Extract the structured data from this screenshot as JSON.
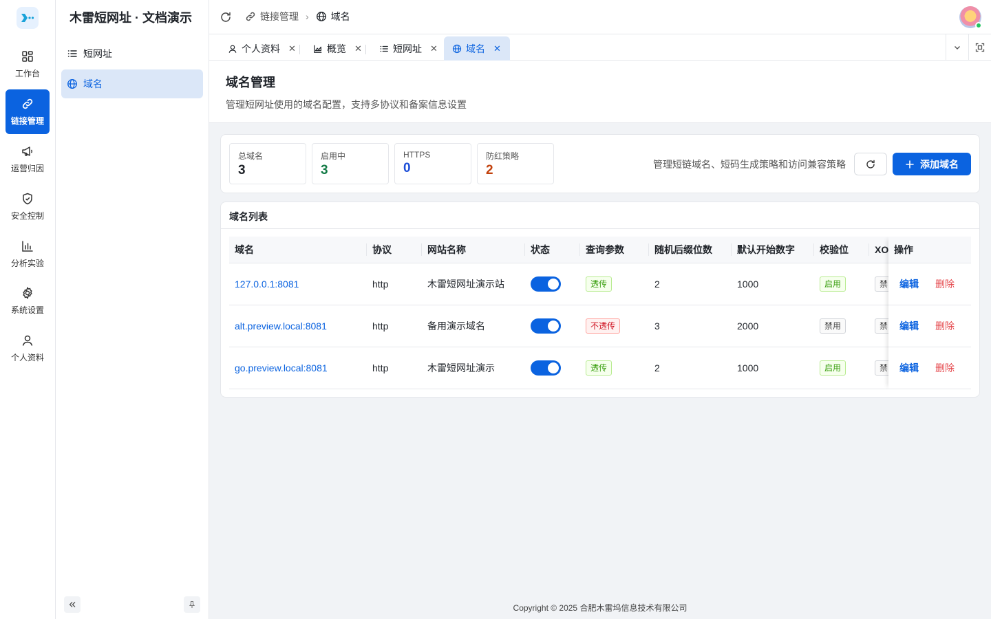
{
  "rail": {
    "items": [
      {
        "label": "工作台",
        "icon": "dashboard-icon"
      },
      {
        "label": "链接管理",
        "icon": "link-icon",
        "active": true
      },
      {
        "label": "运营归因",
        "icon": "megaphone-icon"
      },
      {
        "label": "安全控制",
        "icon": "shield-icon"
      },
      {
        "label": "分析实验",
        "icon": "bar-chart-icon"
      },
      {
        "label": "系统设置",
        "icon": "gear-icon"
      },
      {
        "label": "个人资料",
        "icon": "user-icon"
      }
    ]
  },
  "sidebar": {
    "title": "木雷短网址 · 文档演示",
    "items": [
      {
        "label": "短网址",
        "icon": "list-icon"
      },
      {
        "label": "域名",
        "icon": "globe-icon",
        "active": true
      }
    ]
  },
  "header": {
    "breadcrumb": {
      "parent": "链接管理",
      "current": "域名"
    }
  },
  "tabs": [
    {
      "label": "个人资料",
      "icon": "user-icon"
    },
    {
      "label": "概览",
      "icon": "area-chart-icon"
    },
    {
      "label": "短网址",
      "icon": "list-icon"
    },
    {
      "label": "域名",
      "icon": "globe-icon",
      "active": true
    }
  ],
  "page": {
    "title": "域名管理",
    "subtitle": "管理短网址使用的域名配置，支持多协议和备案信息设置"
  },
  "stats": [
    {
      "label": "总域名",
      "value": "3",
      "color": "#1f2329"
    },
    {
      "label": "启用中",
      "value": "3",
      "color": "#127a45"
    },
    {
      "label": "HTTPS",
      "value": "0",
      "color": "#1d4ed8"
    },
    {
      "label": "防红策略",
      "value": "2",
      "color": "#c2410c"
    }
  ],
  "toolbar": {
    "description": "管理短链域名、短码生成策略和访问兼容策略",
    "add_label": "添加域名"
  },
  "table": {
    "title": "域名列表",
    "columns": [
      "域名",
      "协议",
      "网站名称",
      "状态",
      "查询参数",
      "随机后缀位数",
      "默认开始数字",
      "校验位",
      "XO"
    ],
    "ops_header": "操作",
    "edit_label": "编辑",
    "delete_label": "删除",
    "rows": [
      {
        "domain": "127.0.0.1:8081",
        "protocol": "http",
        "site": "木雷短网址演示站",
        "enabled": true,
        "query": "透传",
        "query_tone": "green",
        "suffix": "2",
        "start": "1000",
        "check": "启用",
        "check_tone": "green",
        "xo": "禁"
      },
      {
        "domain": "alt.preview.local:8081",
        "protocol": "http",
        "site": "备用演示域名",
        "enabled": true,
        "query": "不透传",
        "query_tone": "red",
        "suffix": "3",
        "start": "2000",
        "check": "禁用",
        "check_tone": "gray",
        "xo": "禁"
      },
      {
        "domain": "go.preview.local:8081",
        "protocol": "http",
        "site": "木雷短网址演示",
        "enabled": true,
        "query": "透传",
        "query_tone": "green",
        "suffix": "2",
        "start": "1000",
        "check": "启用",
        "check_tone": "green",
        "xo": "禁"
      }
    ]
  },
  "footer": {
    "copyright": "Copyright © 2025 合肥木雷坞信息技术有限公司"
  }
}
